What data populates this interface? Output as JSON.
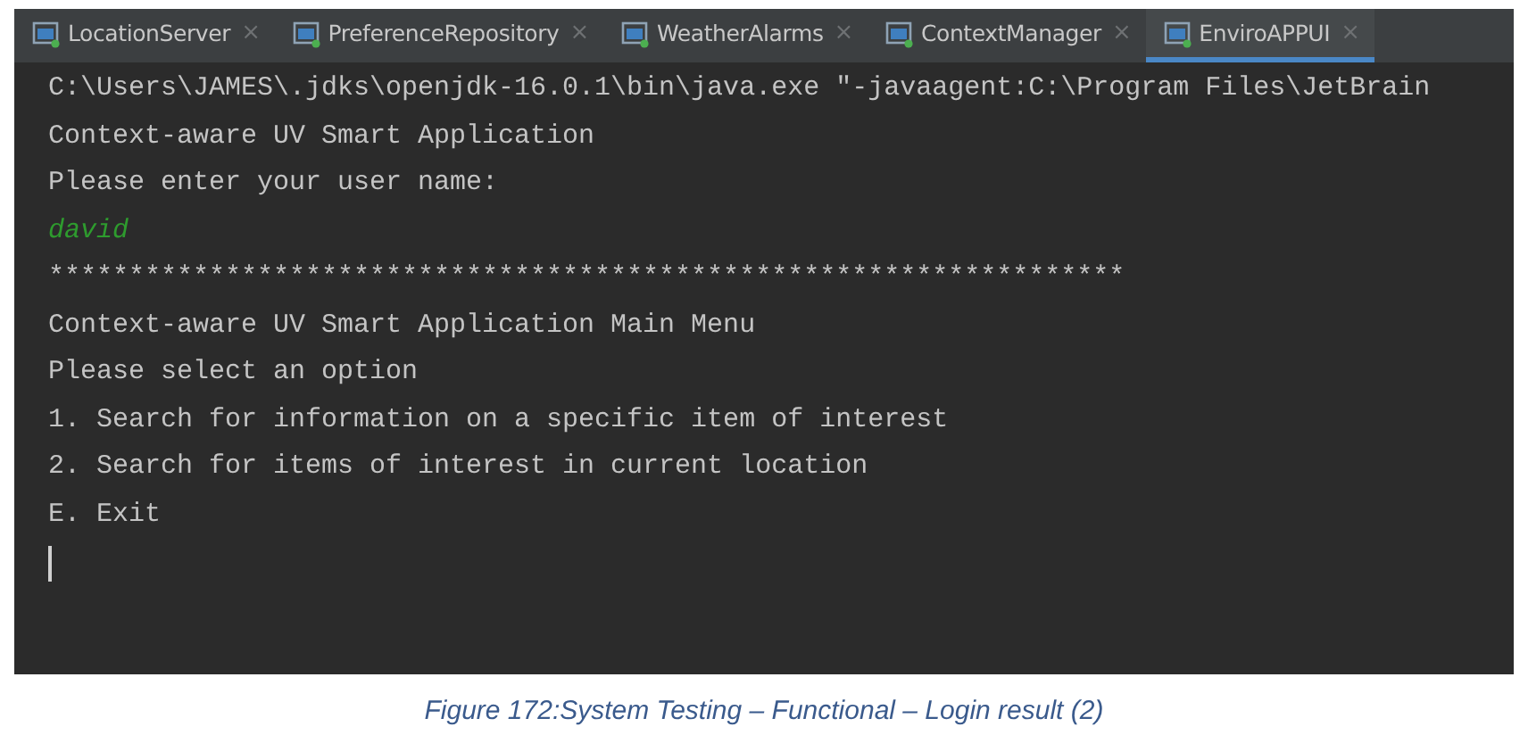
{
  "tabs": [
    {
      "label": "LocationServer",
      "close": "×",
      "selected": false
    },
    {
      "label": "PreferenceRepository",
      "close": "×",
      "selected": false
    },
    {
      "label": "WeatherAlarms",
      "close": "×",
      "selected": false
    },
    {
      "label": "ContextManager",
      "close": "×",
      "selected": false
    },
    {
      "label": "EnviroAPPUI",
      "close": "×",
      "selected": true
    }
  ],
  "console": {
    "lines": [
      {
        "kind": "output",
        "text": "C:\\Users\\JAMES\\.jdks\\openjdk-16.0.1\\bin\\java.exe \"-javaagent:C:\\Program Files\\JetBrain"
      },
      {
        "kind": "output",
        "text": "Context-aware UV Smart Application"
      },
      {
        "kind": "output",
        "text": "Please enter your user name:"
      },
      {
        "kind": "input",
        "text": "david"
      },
      {
        "kind": "output",
        "text": "*******************************************************************"
      },
      {
        "kind": "output",
        "text": "Context-aware UV Smart Application Main Menu"
      },
      {
        "kind": "output",
        "text": "Please select an option"
      },
      {
        "kind": "output",
        "text": "1. Search for information on a specific item of interest"
      },
      {
        "kind": "output",
        "text": "2. Search for items of interest in current location"
      },
      {
        "kind": "output",
        "text": "E. Exit"
      },
      {
        "kind": "cursor"
      }
    ]
  },
  "caption": "Figure 172:System Testing – Functional – Login result (2)"
}
